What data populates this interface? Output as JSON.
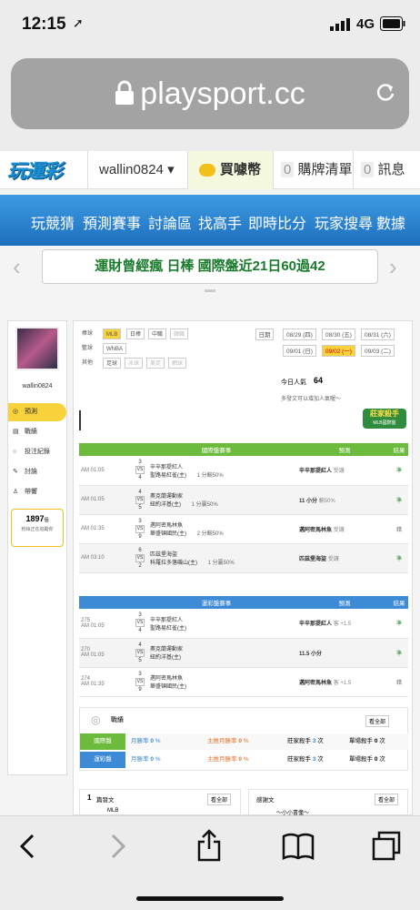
{
  "status": {
    "time": "12:15",
    "network": "4G"
  },
  "browser": {
    "url": "playsport.cc"
  },
  "site": {
    "logo": "玩運彩",
    "username": "wallin0824",
    "buy_coins": "買噱幣",
    "cart_count": "0",
    "cart_label": "購牌清單",
    "msg_count": "0",
    "msg_label": "訊息"
  },
  "nav": [
    "玩競猜",
    "預測賽事",
    "討論區",
    "找高手",
    "即時比分",
    "玩家搜尋",
    "數據"
  ],
  "banner": "運財曾經瘋 日棒 國際盤近21日60過42",
  "sidebar": {
    "username": "wallin0824",
    "items": [
      "預測",
      "戰績",
      "投注紀錄",
      "討論",
      "帶響"
    ],
    "fans_count": "1897",
    "fans_suffix": "個",
    "fans_note": "粉絲正在追蹤你"
  },
  "filters": {
    "baseball_label": "棒球",
    "baseball": [
      "MLB",
      "日棒",
      "中職",
      "韓職"
    ],
    "basket_label": "籃球",
    "basket": [
      "WNBA"
    ],
    "other_label": "其他",
    "other": [
      "足球",
      "冰球",
      "美足",
      "網球"
    ],
    "date_label": "日期",
    "dates": [
      "08/29 (四)",
      "08/30 (五)",
      "08/31 (六)",
      "09/01 (日)",
      "09/02 (一)",
      "09/03 (二)"
    ]
  },
  "popularity": {
    "label": "今日人氣",
    "value": "64",
    "note": "多發文可以增加人氣喔～",
    "badge": "莊家殺手",
    "badge_sub": "MLB國際盤"
  },
  "intl": {
    "header": "國際盤賽事",
    "pred_header": "預測",
    "result_header": "結果",
    "rows": [
      {
        "time": "AM 01:05",
        "a": "3",
        "b": "4",
        "team1": "辛辛那提紅人",
        "team2": "聖路易紅雀(主)",
        "line": "1 分輸50%",
        "pred": "辛辛那提紅人",
        "pred_note": "受讓",
        "res": "準"
      },
      {
        "time": "AM 01:05",
        "a": "4",
        "b": "5",
        "team1": "奧克蘭運動家",
        "team2": "紐約洋基(主)",
        "line": "1 分贏50%",
        "pred": "11 小分",
        "pred_note": "輸50%",
        "res": "準"
      },
      {
        "time": "AM 01:35",
        "a": "3",
        "b": "9",
        "team1": "邁阿密馬林魚",
        "team2": "華盛頓國民(主)",
        "line": "2 分輸50%",
        "pred": "邁阿密馬林魚",
        "pred_note": "受讓",
        "res": "錯"
      },
      {
        "time": "AM 03:10",
        "a": "6",
        "b": "2",
        "team1": "匹茲堡海盜",
        "team2": "科羅拉多落磯山(主)",
        "line": "1 分贏50%",
        "pred": "匹茲堡海盜",
        "pred_note": "受讓",
        "res": "準"
      }
    ]
  },
  "lottery": {
    "header": "運彩盤賽事",
    "pred_header": "預測",
    "result_header": "結果",
    "rows": [
      {
        "num": "275",
        "time": "AM 01:05",
        "a": "3",
        "b": "4",
        "team1": "辛辛那提紅人",
        "team2": "聖路易紅雀(主)",
        "pred": "辛辛那提紅人",
        "pred_note": "客 +1.5",
        "res": "準"
      },
      {
        "num": "270",
        "time": "AM 01:05",
        "a": "4",
        "b": "5",
        "team1": "奧克蘭運動家",
        "team2": "紐約洋基(主)",
        "pred": "11.5 小分",
        "pred_note": "",
        "res": "準"
      },
      {
        "num": "274",
        "time": "AM 01:35",
        "a": "3",
        "b": "9",
        "team1": "邁阿密馬林魚",
        "team2": "華盛頓國民(主)",
        "pred": "邁阿密馬林魚",
        "pred_note": "客 +1.5",
        "res": "錯"
      }
    ]
  },
  "record": {
    "title": "戰績",
    "more": "看全部",
    "intl_label": "國際盤",
    "lot_label": "運彩盤",
    "month_rate": "月勝率",
    "month_rate_val": "0",
    "pct": "%",
    "home_rate": "主推月勝率",
    "home_rate_val": "0",
    "killer": "莊家殺手",
    "killer_intl": "3",
    "killer_lot": "3",
    "times": "次",
    "single_kill": "單場殺手",
    "single_val": "0"
  },
  "posts": {
    "left_title": "篇發文",
    "left_count": "1",
    "more": "看全部",
    "right_title": "感謝文",
    "right_more": "看全部",
    "left_item": "MLB",
    "right_item": "～小小書僮～"
  }
}
